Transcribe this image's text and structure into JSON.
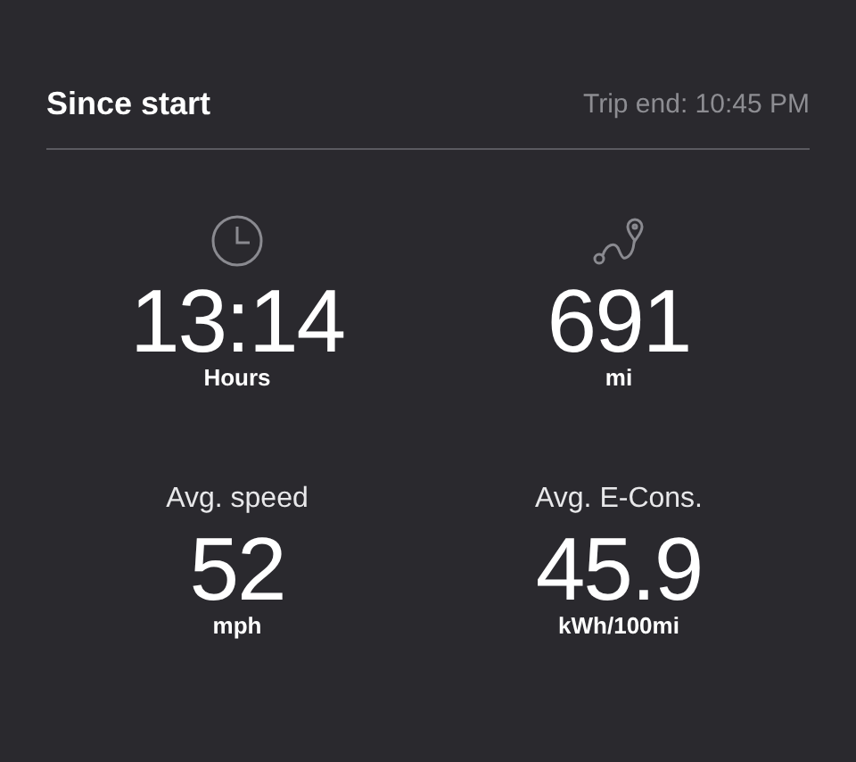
{
  "header": {
    "title": "Since start",
    "trip_end": "Trip end: 10:45 PM"
  },
  "stats": [
    {
      "kind": "clock",
      "value": "13:14",
      "unit": "Hours"
    },
    {
      "kind": "route",
      "value": "691",
      "unit": "mi"
    },
    {
      "kind": "labeled",
      "label": "Avg. speed",
      "value": "52",
      "unit": "mph"
    },
    {
      "kind": "labeled",
      "label": "Avg. E-Cons.",
      "value": "45.9",
      "unit": "kWh/100mi"
    }
  ]
}
